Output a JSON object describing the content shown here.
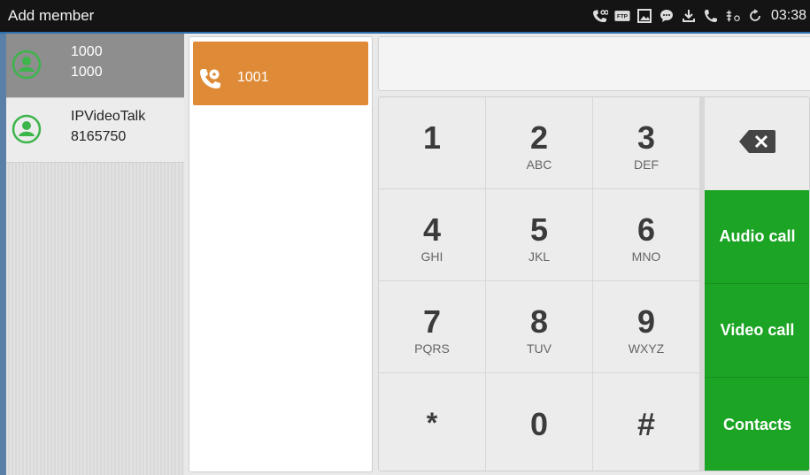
{
  "status_bar": {
    "title": "Add member",
    "time": "03:38",
    "icons": [
      "voicemail-icon",
      "ftp-icon",
      "picture-icon",
      "chat-icon",
      "download-icon",
      "phone-icon",
      "usb-icon",
      "sync-icon"
    ],
    "ftp_label": "FTP"
  },
  "contacts": [
    {
      "name": "1000",
      "number": "1000",
      "selected": true
    },
    {
      "name": "IPVideoTalk",
      "number": "8165750",
      "selected": false
    }
  ],
  "members": [
    {
      "number": "1001"
    }
  ],
  "dial_input": {
    "value": ""
  },
  "keypad": {
    "keys": [
      {
        "digit": "1",
        "letters": ""
      },
      {
        "digit": "2",
        "letters": "ABC"
      },
      {
        "digit": "3",
        "letters": "DEF"
      },
      {
        "digit": "4",
        "letters": "GHI"
      },
      {
        "digit": "5",
        "letters": "JKL"
      },
      {
        "digit": "6",
        "letters": "MNO"
      },
      {
        "digit": "7",
        "letters": "PQRS"
      },
      {
        "digit": "8",
        "letters": "TUV"
      },
      {
        "digit": "9",
        "letters": "WXYZ"
      },
      {
        "digit": "*",
        "letters": ""
      },
      {
        "digit": "0",
        "letters": ""
      },
      {
        "digit": "#",
        "letters": ""
      }
    ],
    "audio_call_label": "Audio call",
    "video_call_label": "Video call",
    "contacts_label": "Contacts"
  },
  "colors": {
    "accent_green": "#1ca424",
    "member_orange": "#df8a37",
    "avatar_green": "#3cb54a"
  }
}
